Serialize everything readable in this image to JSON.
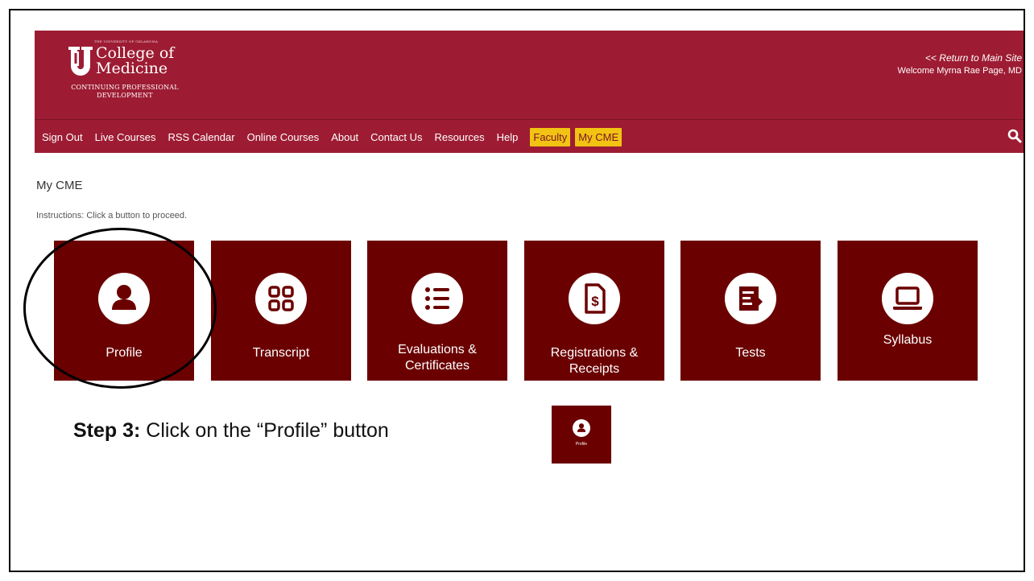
{
  "header": {
    "logo": {
      "tiny_text": "THE UNIVERSITY OF OKLAHOMA",
      "line1": "College of",
      "line2": "Medicine",
      "sub1": "CONTINUING PROFESSIONAL",
      "sub2": "DEVELOPMENT"
    },
    "return_link": "<< Return to Main Site",
    "welcome": "Welcome Myrna Rae Page, MD"
  },
  "nav": {
    "items": [
      {
        "label": "Sign Out"
      },
      {
        "label": "Live Courses"
      },
      {
        "label": "RSS Calendar"
      },
      {
        "label": "Online Courses"
      },
      {
        "label": "About"
      },
      {
        "label": "Contact Us"
      },
      {
        "label": "Resources"
      },
      {
        "label": "Help"
      },
      {
        "label": "Faculty"
      },
      {
        "label": "My CME"
      }
    ],
    "search_icon": "search-icon"
  },
  "page": {
    "title": "My CME",
    "instructions": "Instructions: Click a button to proceed."
  },
  "tiles": [
    {
      "line1": "Profile",
      "line2": "",
      "icon": "user-icon"
    },
    {
      "line1": "Transcript",
      "line2": "",
      "icon": "grid-icon"
    },
    {
      "line1": "Evaluations &",
      "line2": "Certificates",
      "icon": "list-icon"
    },
    {
      "line1": "Registrations &",
      "line2": "Receipts",
      "icon": "receipt-dollar-icon"
    },
    {
      "line1": "Tests",
      "line2": "",
      "icon": "test-document-icon"
    },
    {
      "line1": "Syllabus",
      "line2": "",
      "icon": "laptop-icon"
    }
  ],
  "annotation": {
    "step_bold": "Step 3:",
    "step_text": " Click on the “Profile”  button",
    "mini_label": "Profile"
  },
  "colors": {
    "header_bg": "#9d1c33",
    "tile_bg": "#6b0000",
    "highlight_nav": "#f2c313"
  }
}
